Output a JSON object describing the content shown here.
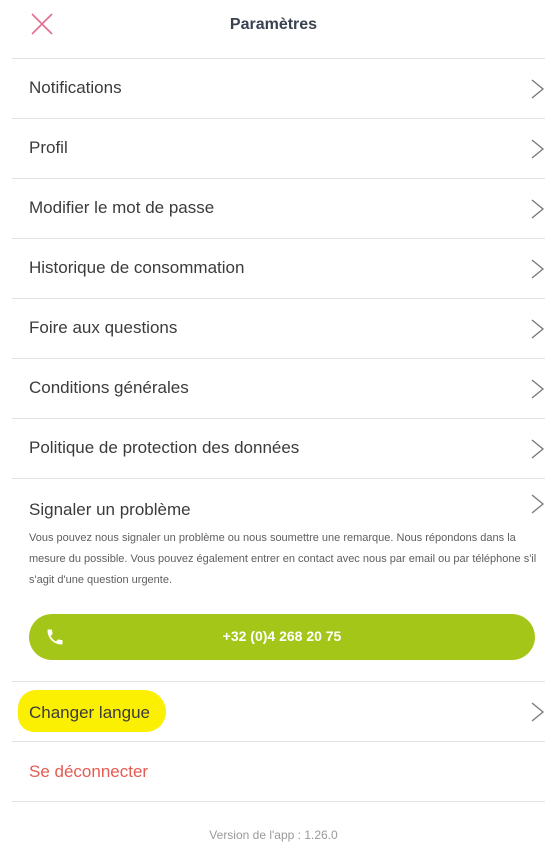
{
  "header": {
    "title": "Paramètres",
    "close_icon": "close-icon",
    "close_color": "#e86c8c"
  },
  "menu": {
    "items": [
      {
        "label": "Notifications"
      },
      {
        "label": "Profil"
      },
      {
        "label": "Modifier le mot de passe"
      },
      {
        "label": "Historique de consommation"
      },
      {
        "label": "Foire aux questions"
      },
      {
        "label": "Conditions générales"
      },
      {
        "label": "Politique de protection des données"
      }
    ]
  },
  "report": {
    "title": "Signaler un problème",
    "description": "Vous pouvez nous signaler un problème ou nous soumettre une remarque. Nous répondons dans la mesure du possible. Vous pouvez également entrer en contact avec nous par email ou par téléphone s'il s'agit d'une question urgente.",
    "phone": "+32 (0)4 268 20 75",
    "phone_icon": "phone-icon",
    "button_color": "#a4c619"
  },
  "language": {
    "label": "Changer langue",
    "highlight_color": "#fbf001"
  },
  "logout": {
    "label": "Se déconnecter",
    "color": "#e45b52"
  },
  "footer": {
    "version": "Version de l'app : 1.26.0"
  },
  "icons": {
    "chevron": "chevron-right-icon"
  }
}
